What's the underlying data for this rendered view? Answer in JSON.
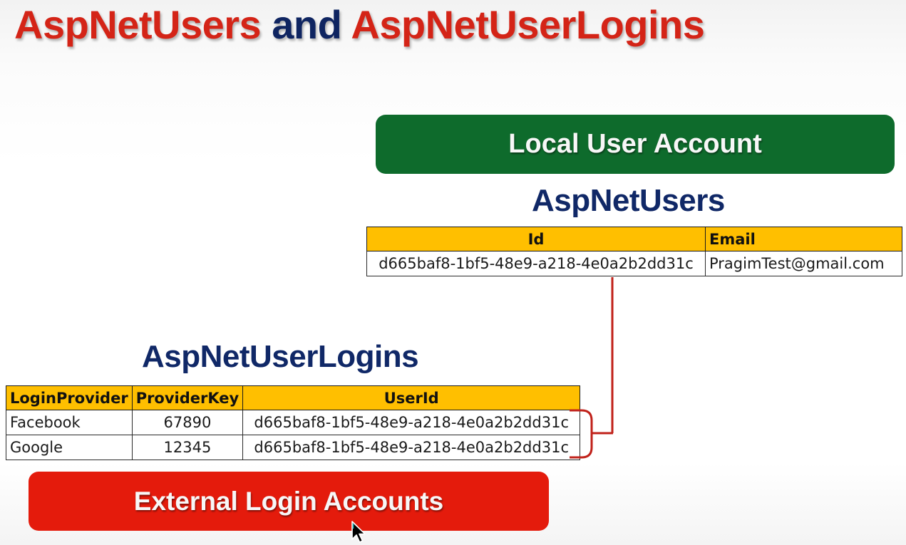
{
  "title": {
    "part1": "AspNetUsers",
    "part2": "and",
    "part3": "AspNetUserLogins",
    "colors": {
      "part1": "#d42417",
      "part2": "#0f2561",
      "part3": "#d42417"
    }
  },
  "local_banner": {
    "label": "Local User Account",
    "color": "#0e6b2c"
  },
  "users_table": {
    "heading": "AspNetUsers",
    "columns": [
      "Id",
      "Email"
    ],
    "rows": [
      [
        "d665baf8-1bf5-48e9-a218-4e0a2b2dd31c",
        "PragimTest@gmail.com"
      ]
    ]
  },
  "logins_table": {
    "heading": "AspNetUserLogins",
    "columns": [
      "LoginProvider",
      "ProviderKey",
      "UserId"
    ],
    "rows": [
      [
        "Facebook",
        "67890",
        "d665baf8-1bf5-48e9-a218-4e0a2b2dd31c"
      ],
      [
        "Google",
        "12345",
        "d665baf8-1bf5-48e9-a218-4e0a2b2dd31c"
      ]
    ]
  },
  "external_banner": {
    "label": "External Login Accounts",
    "color": "#e41b0c"
  },
  "header_fill_color": "#ffbf00",
  "connector_color": "#c0211a",
  "icons": {
    "cursor": "mouse-pointer-icon"
  }
}
